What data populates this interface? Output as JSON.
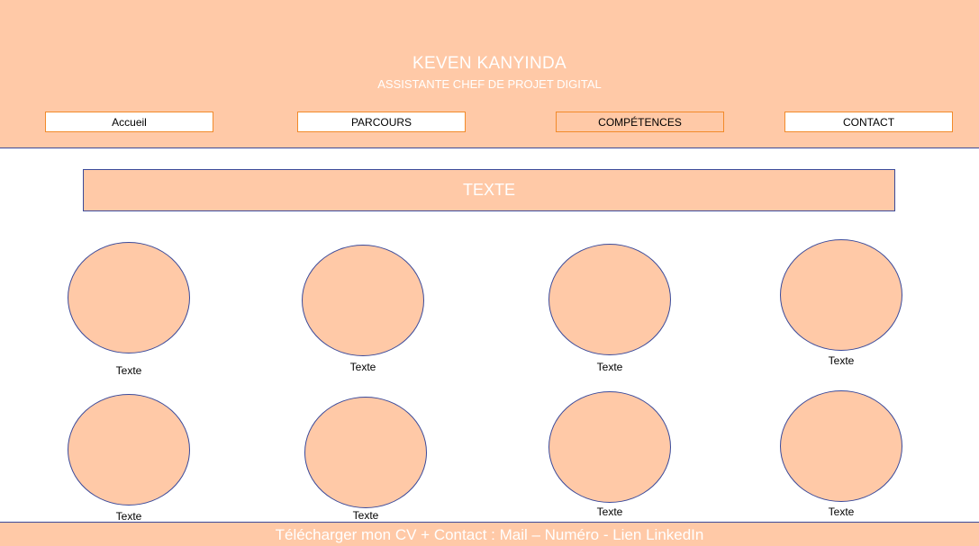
{
  "header": {
    "name": "KEVEN KANYINDA",
    "subtitle": "ASSISTANTE CHEF DE PROJET DIGITAL"
  },
  "nav": [
    {
      "label": "Accueil"
    },
    {
      "label": "PARCOURS"
    },
    {
      "label": "COMPÉTENCES"
    },
    {
      "label": "CONTACT"
    }
  ],
  "banner": {
    "text": "TEXTE"
  },
  "skills": [
    {
      "label": "Texte"
    },
    {
      "label": "Texte"
    },
    {
      "label": "Texte"
    },
    {
      "label": "Texte"
    },
    {
      "label": "Texte"
    },
    {
      "label": "Texte"
    },
    {
      "label": "Texte"
    },
    {
      "label": "Texte"
    }
  ],
  "footer": {
    "text": "Télécharger mon CV + Contact : Mail – Numéro - Lien LinkedIn"
  },
  "colors": {
    "peach": "#ffc9a7",
    "orange_border": "#f28a2a",
    "navy_border": "#3b4a9a"
  }
}
